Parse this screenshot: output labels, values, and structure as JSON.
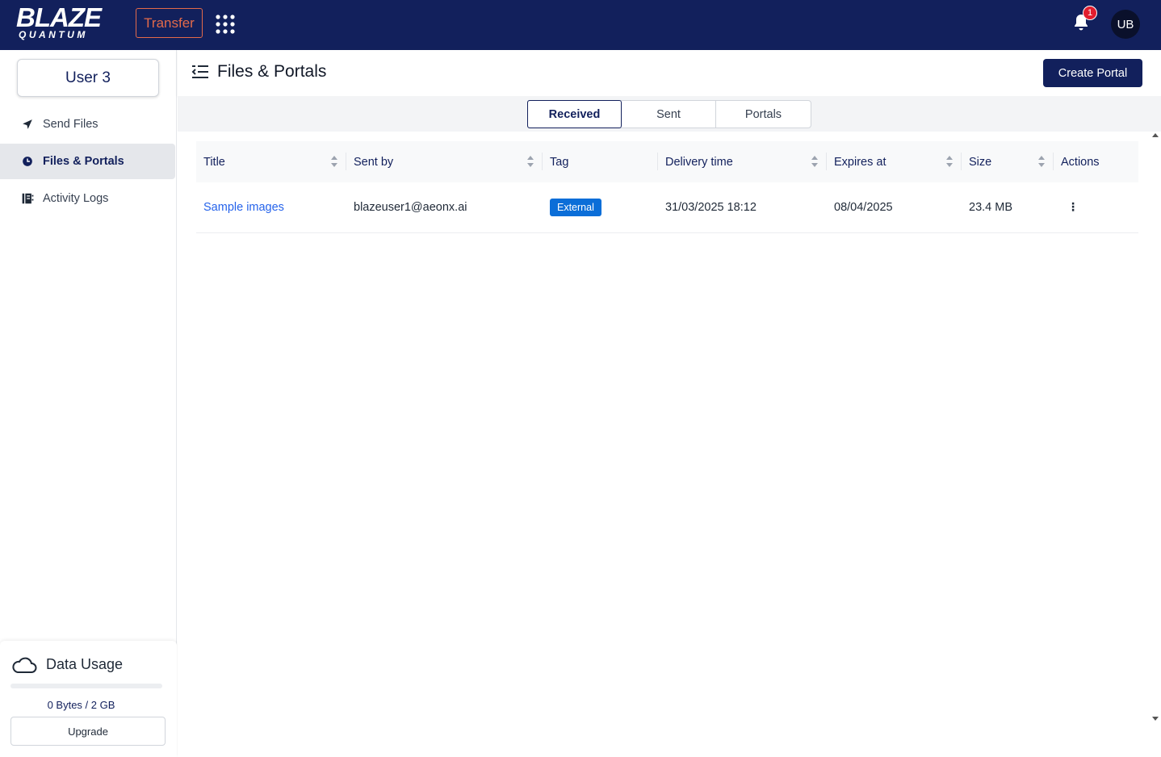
{
  "app": {
    "logo_main": "BLAZE",
    "logo_sub": "QUANTUM",
    "transfer_label": "Transfer",
    "notification_count": "1",
    "avatar_initials": "UB",
    "colors": {
      "navy": "#12205c",
      "accent": "#e36a4a",
      "tag_blue": "#0b6ed8",
      "link": "#2563eb",
      "badge_red": "#e11d2e"
    }
  },
  "sidebar": {
    "user_name": "User 3",
    "items": [
      {
        "label": "Send Files",
        "icon": "send-icon",
        "active": false
      },
      {
        "label": "Files & Portals",
        "icon": "files-portals-icon",
        "active": true
      },
      {
        "label": "Activity Logs",
        "icon": "activity-logs-icon",
        "active": false
      }
    ],
    "data_usage": {
      "title": "Data Usage",
      "used_text": "0 Bytes / 2 GB",
      "used_fraction": 0,
      "upgrade_label": "Upgrade"
    }
  },
  "header": {
    "title": "Files & Portals",
    "create_portal_label": "Create Portal"
  },
  "tabs": [
    {
      "label": "Received",
      "active": true
    },
    {
      "label": "Sent",
      "active": false
    },
    {
      "label": "Portals",
      "active": false
    }
  ],
  "table": {
    "columns": [
      "Title",
      "Sent by",
      "Tag",
      "Delivery time",
      "Expires at",
      "Size",
      "Actions"
    ],
    "rows": [
      {
        "title": "Sample images",
        "sent_by": "blazeuser1@aeonx.ai",
        "tag": "External",
        "delivery_time": "31/03/2025 18:12",
        "expires_at": "08/04/2025",
        "size": "23.4 MB",
        "actions": "⋮"
      }
    ]
  }
}
